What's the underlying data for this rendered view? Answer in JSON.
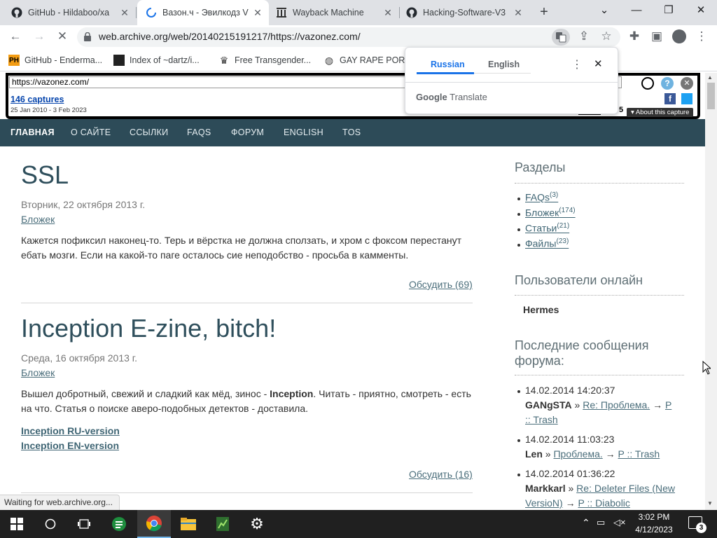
{
  "tabs": [
    {
      "title": "GitHub - Hildaboo/xa",
      "close": "✕"
    },
    {
      "title": "Вазон.ч - Эвилкодз V",
      "close": "✕"
    },
    {
      "title": "Wayback Machine",
      "close": "✕"
    },
    {
      "title": "Hacking-Software-V3",
      "close": "✕"
    }
  ],
  "new_tab": "+",
  "window_controls": {
    "dropdown": "⌄",
    "minimize": "—",
    "maximize": "❐",
    "close": "✕"
  },
  "address": {
    "url": "web.archive.org/web/20140215191217/https://vazonez.com/"
  },
  "bookmarks": [
    {
      "label": "GitHub - Enderma...",
      "icon": "PH"
    },
    {
      "label": "Index of ~dartz/i...",
      "icon": ""
    },
    {
      "label": "Free Transgender...",
      "icon": ""
    },
    {
      "label": "GAY RAPE PORN",
      "icon": ""
    }
  ],
  "wayback": {
    "url_value": "https://vazonez.com/",
    "captures": "146 captures",
    "date_range": "25 Jan 2010 - 3 Feb 2023",
    "year_fragment": "5",
    "about": "About this capture"
  },
  "translate": {
    "lang_from": "Russian",
    "lang_to": "English",
    "brand": "Google",
    "brand_suffix": "Translate"
  },
  "nav": [
    "ГЛАВНАЯ",
    "О САЙТЕ",
    "ССЫЛКИ",
    "FAQS",
    "ФОРУМ",
    "ENGLISH",
    "TOS"
  ],
  "posts": [
    {
      "title": "SSL",
      "date": "Вторник, 22 октября 2013 г.",
      "category": "Бложек",
      "body_line1": "Кажется пофиксил наконец-то. Терь и вёрстка не должна сползать, и хром с фоксом перестанут",
      "body_line2": "ебать мозги. Если на какой-то паге осталось сие неподобство - просьба в камменты.",
      "comments": "Обсудить (69)"
    },
    {
      "title": "Inception E-zine, bitch!",
      "date": "Среда, 16 октября 2013 г.",
      "category": "Бложек",
      "body_line1_a": "Вышел добротный, свежий и сладкий как мёд, зинос - ",
      "body_line1_b": "Inception",
      "body_line1_c": ". Читать - приятно, смотреть - есть",
      "body_line2": "на что. Статья о поиске аверо-подобных детектов - доставила.",
      "link1": "Inception RU-version",
      "link2": "Inception EN-version",
      "comments": "Обсудить (16)"
    }
  ],
  "sidebar": {
    "sections_title": "Разделы",
    "sections": [
      {
        "label": "FAQs",
        "count": "(3)"
      },
      {
        "label": "Бложек",
        "count": "(174)"
      },
      {
        "label": "Статьи",
        "count": "(21)"
      },
      {
        "label": "Файлы",
        "count": "(23)"
      }
    ],
    "online_title": "Пользователи онлайн",
    "online_user": "Hermes",
    "forum_title_1": "Последние сообщения",
    "forum_title_2": "форума:",
    "forum": [
      {
        "date": "14.02.2014 14:20:37",
        "user": "GANgSTA",
        "sep": " » ",
        "topic": "Re: Проблема.",
        "arrow": "→",
        "section_a": "P",
        "section_b": ":: Trash"
      },
      {
        "date": "14.02.2014 11:03:23",
        "user": "Len",
        "sep": " » ",
        "topic": "Проблема.",
        "arrow": "→",
        "section": "P :: Trash"
      },
      {
        "date": "14.02.2014 01:36:22",
        "user": "Markkarl",
        "sep": " » ",
        "topic_a": "Re: Deleter Files (New",
        "topic_b": "VersioN)",
        "arrow": "→",
        "section": "P :: Diabolic"
      }
    ]
  },
  "status": "Waiting for web.archive.org...",
  "taskbar": {
    "time": "3:02 PM",
    "date": "4/12/2023",
    "notifications": "3"
  },
  "colors": {
    "nav_bg": "#2d4b58",
    "title": "#2f4f5c",
    "link": "#4b6e7b",
    "translate_accent": "#1a73e8"
  }
}
